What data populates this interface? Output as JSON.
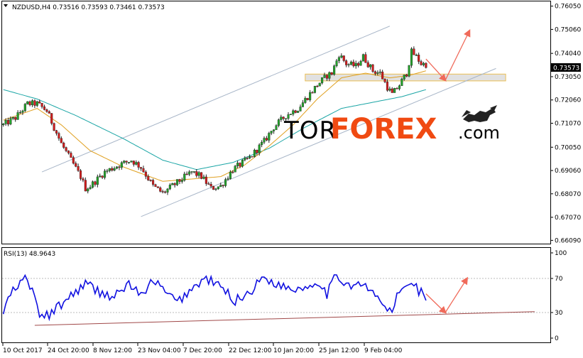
{
  "chart_data": [
    {
      "type": "candlestick",
      "symbol_info": "NZDUSD,H4  0.73516 0.73593 0.73461 0.73573",
      "current_price_label": "0.73573",
      "y_ticks": [
        "0.76050",
        "0.75060",
        "0.74040",
        "0.73050",
        "0.72060",
        "0.71070",
        "0.70050",
        "0.69060",
        "0.68070",
        "0.67070",
        "0.66090"
      ],
      "y_tick_values": [
        0.7605,
        0.7506,
        0.7404,
        0.7305,
        0.7206,
        0.7107,
        0.7005,
        0.6906,
        0.6807,
        0.6707,
        0.6609
      ],
      "ylim": [
        0.6595,
        0.7625
      ],
      "x_ticks": [
        "10 Oct 2017",
        "24 Oct 20:00",
        "8 Nov 12:00",
        "23 Nov 04:00",
        "7 Dec 20:00",
        "22 Dec 12:00",
        "10 Jan 20:00",
        "25 Jan 12:00",
        "9 Feb 04:00"
      ],
      "close_path": [
        [
          0,
          0.71
        ],
        [
          5,
          0.713
        ],
        [
          10,
          0.719
        ],
        [
          14,
          0.719
        ],
        [
          18,
          0.716
        ],
        [
          24,
          0.702
        ],
        [
          28,
          0.695
        ],
        [
          32,
          0.688
        ],
        [
          34,
          0.683
        ],
        [
          36,
          0.684
        ],
        [
          42,
          0.69
        ],
        [
          48,
          0.693
        ],
        [
          53,
          0.695
        ],
        [
          57,
          0.692
        ],
        [
          62,
          0.684
        ],
        [
          66,
          0.681
        ],
        [
          70,
          0.684
        ],
        [
          74,
          0.687
        ],
        [
          78,
          0.69
        ],
        [
          82,
          0.688
        ],
        [
          86,
          0.683
        ],
        [
          90,
          0.684
        ],
        [
          95,
          0.691
        ],
        [
          102,
          0.696
        ],
        [
          108,
          0.703
        ],
        [
          112,
          0.709
        ],
        [
          117,
          0.714
        ],
        [
          122,
          0.717
        ],
        [
          126,
          0.722
        ],
        [
          130,
          0.727
        ],
        [
          134,
          0.731
        ],
        [
          136,
          0.732
        ],
        [
          139,
          0.74
        ],
        [
          142,
          0.736
        ],
        [
          146,
          0.735
        ],
        [
          149,
          0.739
        ],
        [
          153,
          0.733
        ],
        [
          156,
          0.732
        ],
        [
          159,
          0.726
        ],
        [
          161,
          0.723
        ],
        [
          164,
          0.727
        ],
        [
          167,
          0.732
        ],
        [
          169,
          0.741
        ],
        [
          171,
          0.739
        ],
        [
          173,
          0.736
        ],
        [
          175,
          0.7357
        ]
      ],
      "ma_fast": [
        [
          0,
          0.712
        ],
        [
          14,
          0.717
        ],
        [
          24,
          0.71
        ],
        [
          36,
          0.699
        ],
        [
          50,
          0.692
        ],
        [
          66,
          0.686
        ],
        [
          78,
          0.687
        ],
        [
          90,
          0.688
        ],
        [
          100,
          0.693
        ],
        [
          110,
          0.701
        ],
        [
          120,
          0.71
        ],
        [
          130,
          0.721
        ],
        [
          140,
          0.73
        ],
        [
          150,
          0.732
        ],
        [
          160,
          0.73
        ],
        [
          168,
          0.731
        ],
        [
          175,
          0.733
        ]
      ],
      "ma_slow": [
        [
          0,
          0.725
        ],
        [
          14,
          0.721
        ],
        [
          30,
          0.714
        ],
        [
          50,
          0.704
        ],
        [
          66,
          0.695
        ],
        [
          80,
          0.691
        ],
        [
          95,
          0.694
        ],
        [
          110,
          0.7
        ],
        [
          125,
          0.709
        ],
        [
          140,
          0.717
        ],
        [
          155,
          0.72
        ],
        [
          165,
          0.722
        ],
        [
          175,
          0.725
        ]
      ],
      "channel_upper": [
        [
          16,
          0.69
        ],
        [
          160,
          0.752
        ]
      ],
      "channel_lower": [
        [
          57,
          0.671
        ],
        [
          204,
          0.734
        ]
      ],
      "resistance_zone": [
        0.7287,
        0.7316
      ],
      "forecast_arrows": [
        [
          [
            175,
            0.738
          ],
          [
            183,
            0.729
          ]
        ],
        [
          [
            183,
            0.729
          ],
          [
            193,
            0.75
          ]
        ]
      ]
    },
    {
      "type": "line",
      "label": "RSI(13) 48.9643",
      "ylim": [
        0,
        100
      ],
      "y_ticks": [
        "100",
        "70",
        "30",
        "0"
      ],
      "y_tick_values": [
        100,
        70,
        30,
        0
      ],
      "levels": [
        70,
        30
      ],
      "series": [
        {
          "values": [
            [
              0,
              30
            ],
            [
              3,
              52
            ],
            [
              6,
              60
            ],
            [
              9,
              70
            ],
            [
              12,
              58
            ],
            [
              14,
              34
            ],
            [
              16,
              24
            ],
            [
              18,
              26
            ],
            [
              22,
              34
            ],
            [
              28,
              50
            ],
            [
              34,
              64
            ],
            [
              40,
              54
            ],
            [
              46,
              48
            ],
            [
              52,
              64
            ],
            [
              58,
              48
            ],
            [
              62,
              70
            ],
            [
              66,
              56
            ],
            [
              72,
              42
            ],
            [
              78,
              58
            ],
            [
              84,
              70
            ],
            [
              90,
              60
            ],
            [
              96,
              44
            ],
            [
              102,
              54
            ],
            [
              108,
              72
            ],
            [
              114,
              62
            ],
            [
              120,
              58
            ],
            [
              126,
              60
            ],
            [
              130,
              68
            ],
            [
              134,
              52
            ],
            [
              138,
              74
            ],
            [
              142,
              64
            ],
            [
              146,
              62
            ],
            [
              149,
              62
            ],
            [
              153,
              52
            ],
            [
              156,
              46
            ],
            [
              159,
              30
            ],
            [
              161,
              34
            ],
            [
              164,
              54
            ],
            [
              167,
              60
            ],
            [
              169,
              68
            ],
            [
              172,
              56
            ],
            [
              175,
              49
            ]
          ]
        }
      ],
      "trendline": [
        [
          13,
          15
        ],
        [
          220,
          31
        ]
      ],
      "forecast_arrows": [
        [
          [
            175,
            52
          ],
          [
            183,
            30
          ]
        ],
        [
          [
            183,
            30
          ],
          [
            192,
            70
          ]
        ]
      ]
    }
  ],
  "watermark": {
    "part1": "TOR",
    "part2": "FOREX",
    "part3": ".com"
  },
  "colors": {
    "candle_up": "#22a32a",
    "candle_down": "#d41c1c",
    "candle_wick": "#222222",
    "ma_fast": "#e0a020",
    "ma_slow": "#1aa5a5",
    "channel": "#a8b6c8",
    "zone_fill": "#dcdcdc",
    "zone_border": "#e8b437",
    "arrow": "#f06a5a",
    "rsi": "#1010e0",
    "rsi_trend": "#a04848",
    "grid_level": "#bbbbbb"
  }
}
